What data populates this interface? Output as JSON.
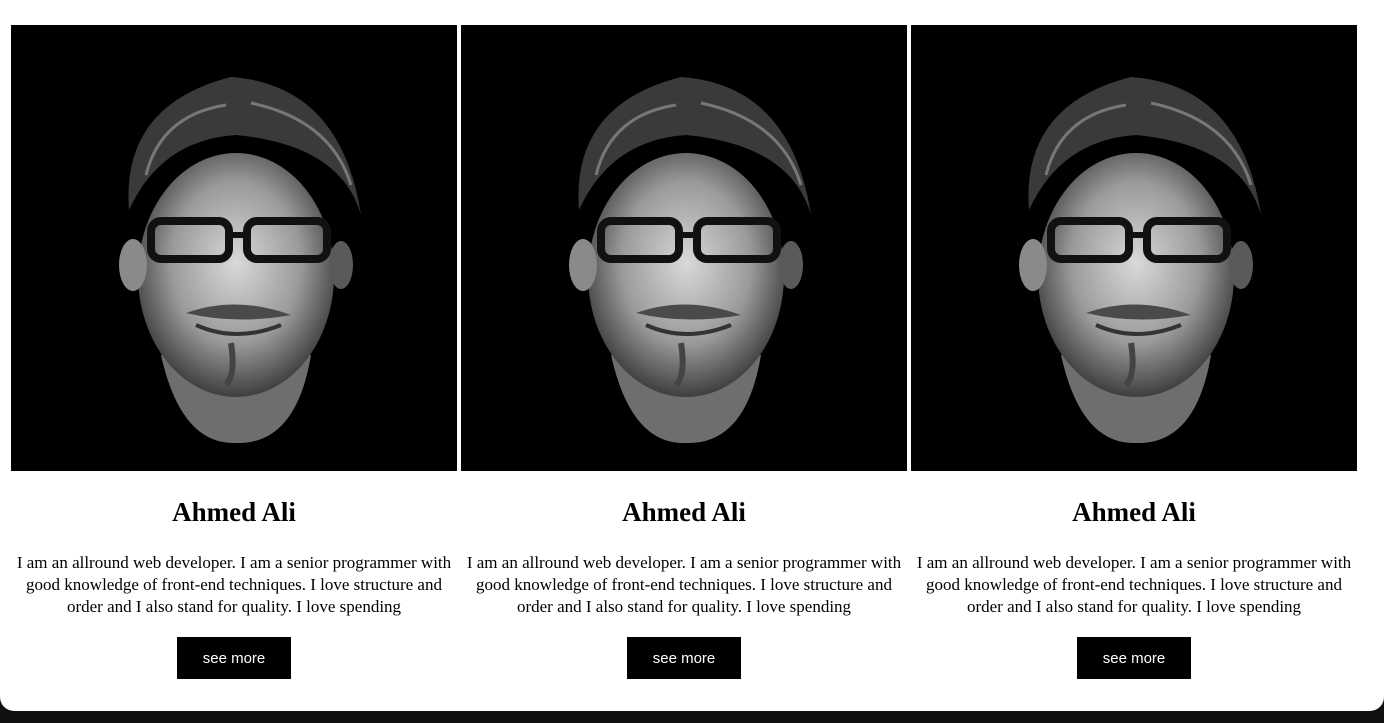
{
  "cards": [
    {
      "photo_icon": "portrait-photo",
      "name": "Ahmed Ali",
      "bio": "I am an allround web developer. I am a senior programmer with good knowledge of front-end techniques. I love structure and order and I also stand for quality. I love spending",
      "button_label": "see more"
    },
    {
      "photo_icon": "portrait-photo",
      "name": "Ahmed Ali",
      "bio": "I am an allround web developer. I am a senior programmer with good knowledge of front-end techniques. I love structure and order and I also stand for quality. I love spending",
      "button_label": "see more"
    },
    {
      "photo_icon": "portrait-photo",
      "name": "Ahmed Ali",
      "bio": "I am an allround web developer. I am a senior programmer with good knowledge of front-end techniques. I love structure and order and I also stand for quality. I love spending",
      "button_label": "see more"
    }
  ],
  "colors": {
    "page_background": "#ffffff",
    "photo_background": "#000000",
    "button_background": "#000000",
    "button_text": "#ffffff"
  }
}
